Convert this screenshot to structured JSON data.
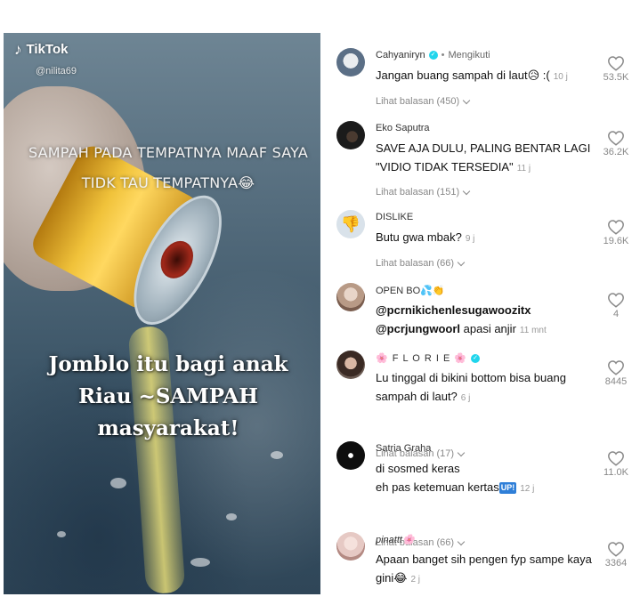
{
  "video": {
    "brand": "TikTok",
    "username": "@nilita69",
    "caption_top": "SAMPAH PADA TEMPATNYA MAAF SAYA TIDK TAU TEMPATNYA😂",
    "caption_main": "Jomblo itu bagi anak Riau ~SAMPAH masyarakat!"
  },
  "comments": [
    {
      "username": "Cahyaniryn",
      "verified": true,
      "follow_label": "Mengikuti",
      "text": "Jangan buang sampah di laut😥 :(",
      "time": "10 j",
      "replies": "Lihat balasan (450)",
      "likes": "53.5K",
      "avatar_color": "#5b6f86"
    },
    {
      "username": "Eko Saputra",
      "text": "SAVE AJA DULU, PALING BENTAR LAGI \"VIDIO TIDAK TERSEDIA\"",
      "time": "11 j",
      "replies": "Lihat balasan (151)",
      "likes": "36.2K",
      "avatar_color": "#1b1b1b"
    },
    {
      "username": "DISLIKE",
      "text": "Butu gwa mbak?",
      "time": "9 j",
      "replies": "Lihat balasan (66)",
      "likes": "19.6K",
      "avatar_color": "#d9e2ea"
    },
    {
      "username": "OPEN BO💦👏",
      "text_line1": "@pcrnikichenlesugawoozitx",
      "text_line2": "@pcrjungwoorl",
      "text_rest": "apasi anjir",
      "time": "11 mnt",
      "likes": "4",
      "avatar_color": "#b89a86"
    },
    {
      "username": "🌸 F L O R I E 🌸",
      "verified": true,
      "text": "Lu tinggal di bikini bottom bisa buang sampah di laut?",
      "time": "6 j",
      "replies": "Lihat balasan (17)",
      "likes": "8445",
      "avatar_color": "#6a5a52"
    },
    {
      "username": "Satria Graha",
      "text_line1": "di sosmed keras",
      "text_line2": "eh pas ketemuan kertas",
      "badge": "UP!",
      "time": "12 j",
      "replies": "Lihat balasan (66)",
      "likes": "11.0K",
      "avatar_color": "#0e0e0e"
    },
    {
      "username": "pinattt🌸",
      "text": "Apaan banget sih pengen fyp sampe kaya gini😂",
      "time": "2 j",
      "likes": "3364",
      "avatar_color": "#e6c9c4"
    }
  ]
}
